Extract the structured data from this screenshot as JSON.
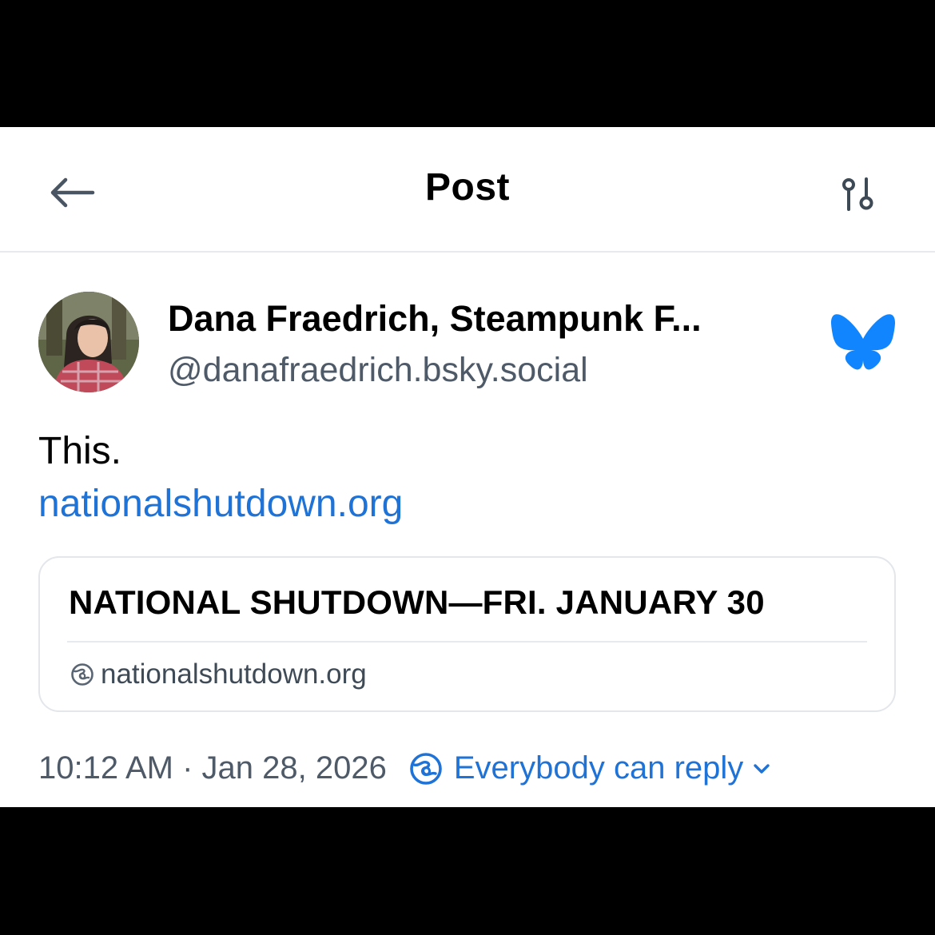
{
  "header": {
    "title": "Post",
    "back_icon": "arrow-left-icon",
    "settings_icon": "sliders-icon"
  },
  "author": {
    "display_name": "Dana Fraedrich, Steampunk F...",
    "handle": "@danafraedrich.bsky.social",
    "avatar": "avatar-photo",
    "logo_icon": "bluesky-butterfly-icon"
  },
  "post": {
    "text": "This.",
    "link_text": "nationalshutdown.org"
  },
  "link_card": {
    "title": "NATIONAL SHUTDOWN—FRI. JANUARY 30",
    "domain": "nationalshutdown.org",
    "domain_icon": "globe-icon"
  },
  "meta": {
    "timestamp": "10:12 AM · Jan 28, 2026",
    "reply_setting": "Everybody can reply",
    "reply_icon": "globe-icon",
    "chevron_icon": "chevron-down-icon"
  },
  "colors": {
    "accent": "#1f72d6",
    "muted_text": "#4f5a68",
    "bluesky_blue": "#1185fe",
    "divider": "#e6e9ed"
  }
}
